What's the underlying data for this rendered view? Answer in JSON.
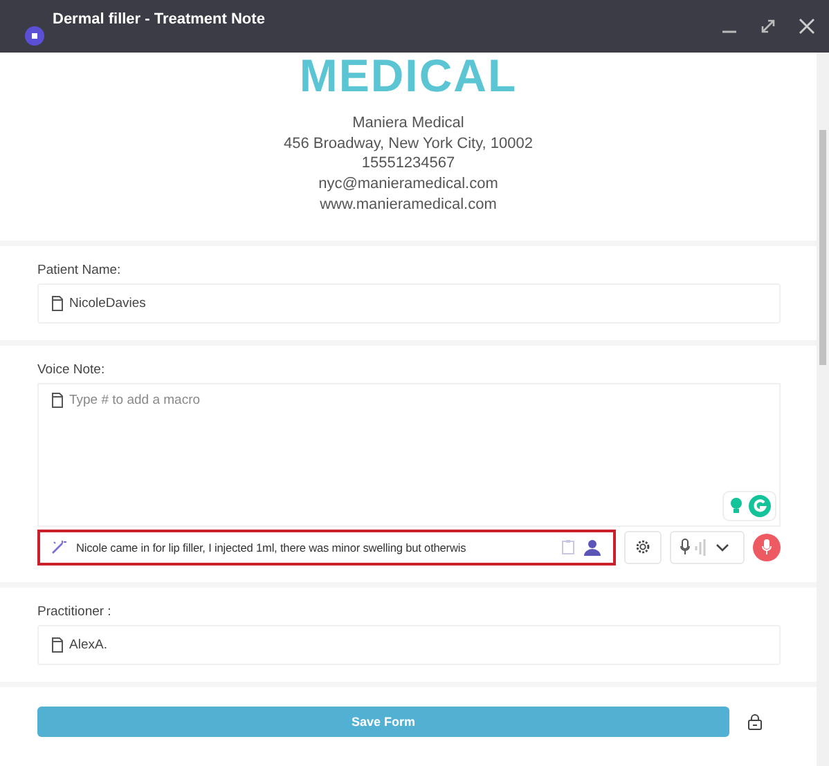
{
  "window": {
    "title": "Dermal filler - Treatment Note"
  },
  "header": {
    "logo": "MEDICAL",
    "lines": [
      "Maniera Medical",
      "456 Broadway, New York City, 10002",
      "15551234567",
      "nyc@manieramedical.com",
      "www.manieramedical.com"
    ]
  },
  "fields": [
    {
      "kind": "text",
      "label": "Patient Name:",
      "value": "NicoleDavies"
    },
    {
      "kind": "voice",
      "label": "Voice Note:",
      "placeholder": "Type # to add a macro",
      "dictation": "Nicole came in for lip filler, I injected 1ml, there was minor swelling but otherwis"
    },
    {
      "kind": "text",
      "label": "Practitioner :",
      "value": "AlexA."
    }
  ],
  "save_button": "Save Form"
}
